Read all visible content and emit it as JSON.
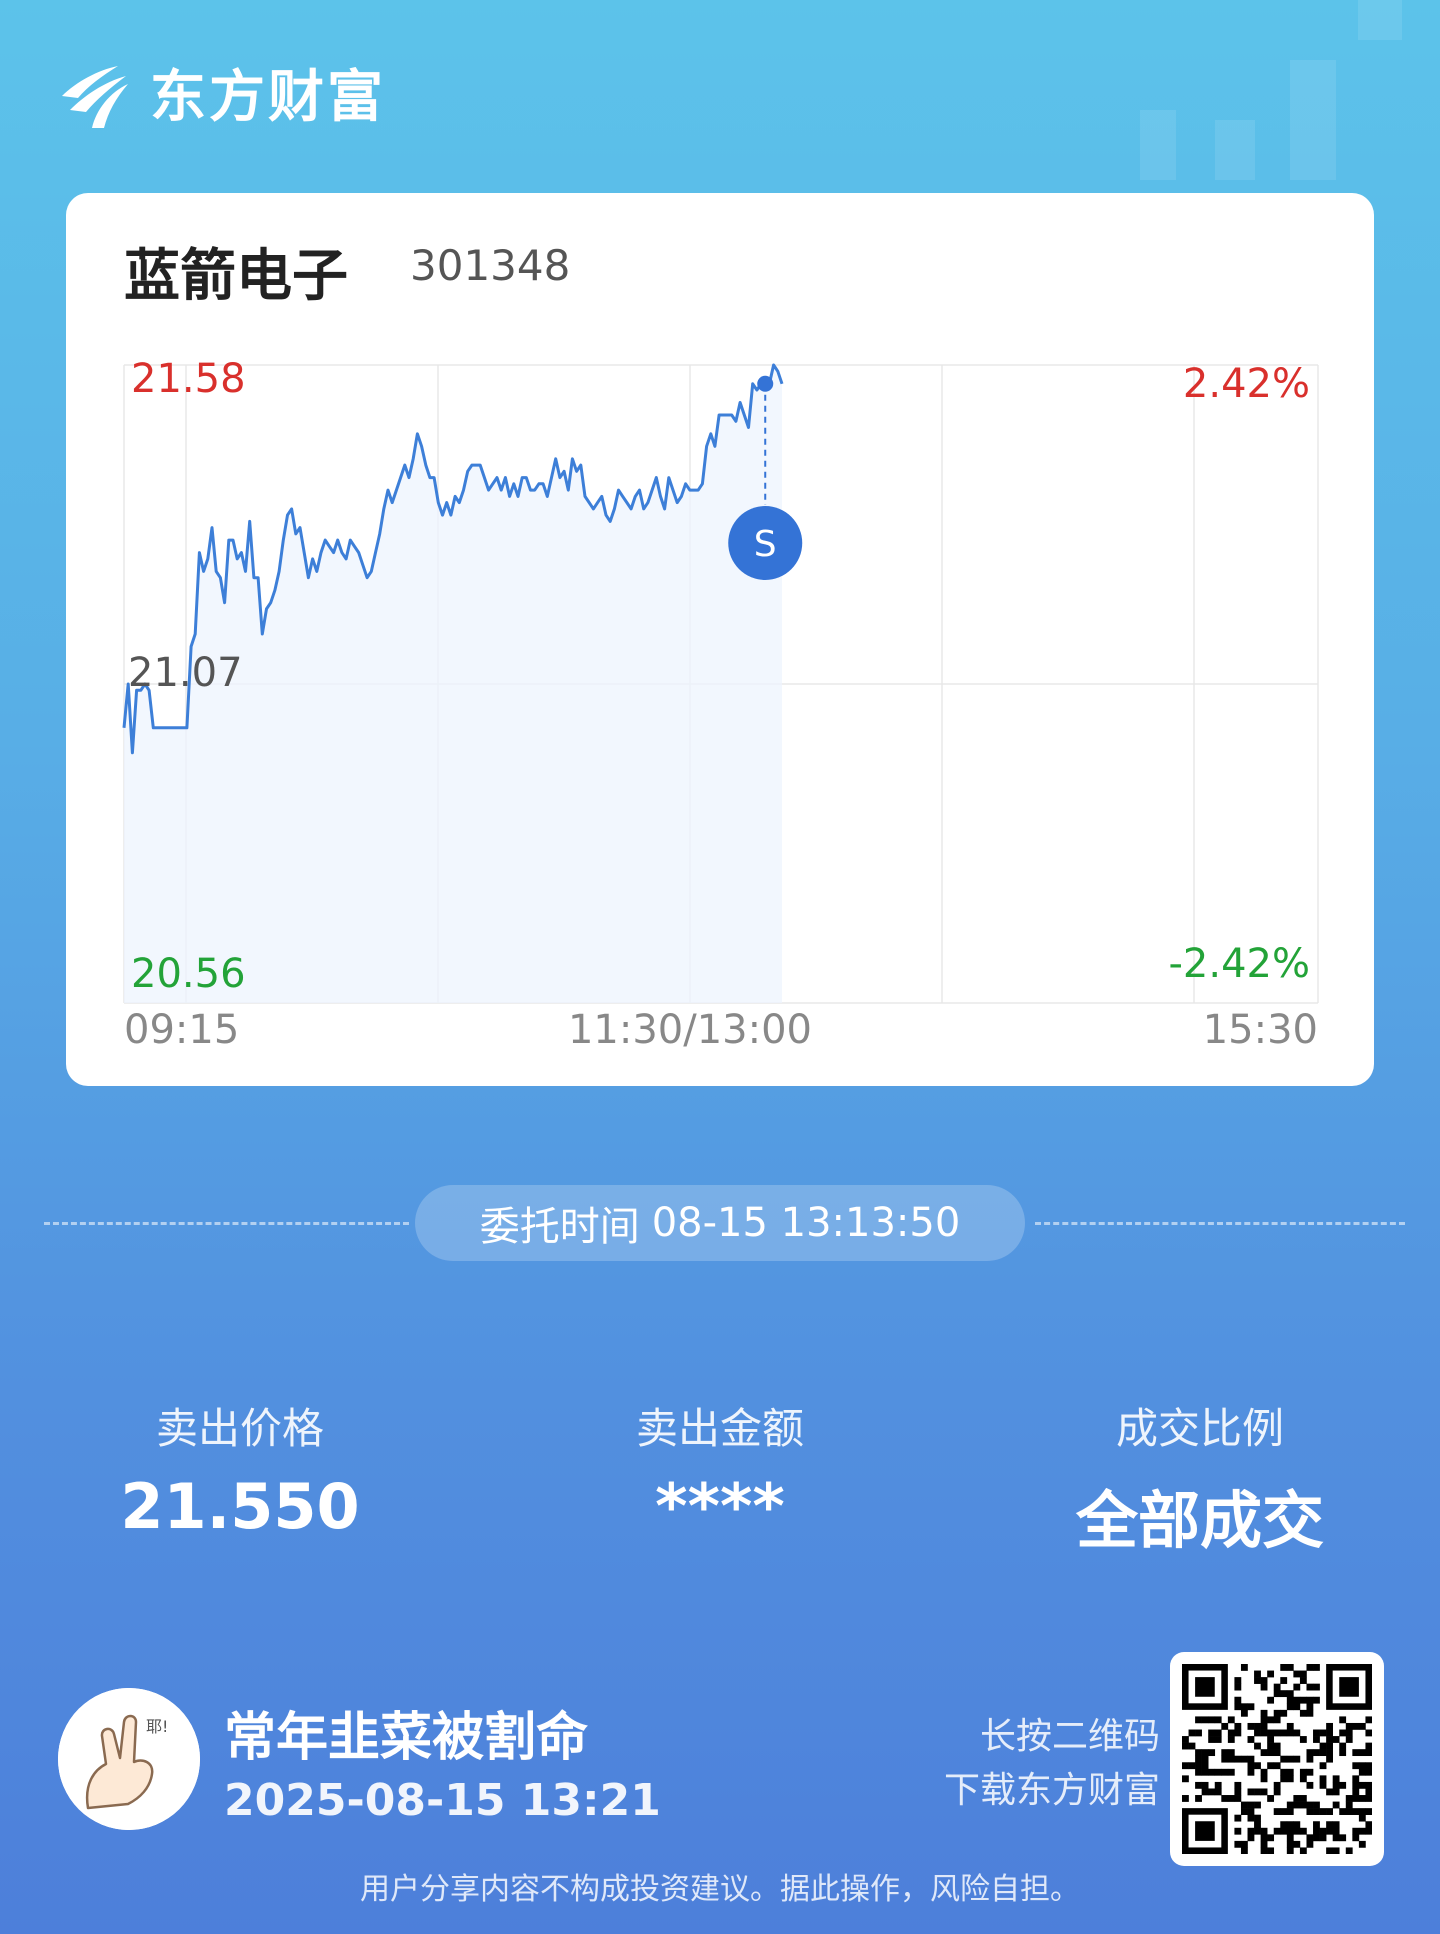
{
  "app": {
    "brand": "东方财富"
  },
  "stock": {
    "name": "蓝箭电子",
    "code": "301348"
  },
  "chart_data": {
    "type": "line",
    "y_axis_left": {
      "top": "21.58",
      "mid": "21.07",
      "bottom": "20.56"
    },
    "y_axis_right": {
      "top": "2.42%",
      "bottom": "-2.42%"
    },
    "x_ticks": [
      "09:15",
      "11:30/13:00",
      "15:30"
    ],
    "ylim": [
      20.56,
      21.58
    ],
    "grid": true,
    "series": [
      {
        "values": [
          21.0,
          21.07,
          20.96,
          21.06,
          21.06,
          21.07,
          21.06,
          21.0,
          21.0,
          21.0,
          21.0,
          21.0,
          21.0,
          21.0,
          21.0,
          21.0,
          21.13,
          21.15,
          21.28,
          21.25,
          21.27,
          21.32,
          21.25,
          21.24,
          21.2,
          21.3,
          21.3,
          21.27,
          21.28,
          21.25,
          21.33,
          21.24,
          21.24,
          21.15,
          21.19,
          21.2,
          21.22,
          21.25,
          21.3,
          21.34,
          21.35,
          21.31,
          21.32,
          21.28,
          21.24,
          21.27,
          21.25,
          21.28,
          21.3,
          21.29,
          21.28,
          21.3,
          21.28,
          21.27,
          21.3,
          21.29,
          21.28,
          21.26,
          21.24,
          21.25,
          21.28,
          21.31,
          21.35,
          21.38,
          21.36,
          21.38,
          21.4,
          21.42,
          21.4,
          21.43,
          21.47,
          21.45,
          21.42,
          21.4,
          21.4,
          21.36,
          21.34,
          21.36,
          21.34,
          21.37,
          21.36,
          21.38,
          21.41,
          21.42,
          21.42,
          21.42,
          21.4,
          21.38,
          21.39,
          21.4,
          21.38,
          21.4,
          21.37,
          21.39,
          21.37,
          21.4,
          21.4,
          21.38,
          21.38,
          21.39,
          21.39,
          21.37,
          21.4,
          21.43,
          21.4,
          21.41,
          21.38,
          21.43,
          21.41,
          21.42,
          21.37,
          21.36,
          21.35,
          21.36,
          21.37,
          21.34,
          21.33,
          21.35,
          21.38,
          21.37,
          21.36,
          21.35,
          21.37,
          21.38,
          21.35,
          21.36,
          21.38,
          21.4,
          21.37,
          21.35,
          21.4,
          21.38,
          21.36,
          21.37,
          21.39,
          21.38,
          21.38,
          21.38,
          21.39,
          21.45,
          21.47,
          21.45,
          21.5,
          21.5,
          21.5,
          21.5,
          21.49,
          21.52,
          21.5,
          21.48,
          21.55,
          21.54,
          21.55,
          21.56,
          21.55,
          21.58,
          21.57,
          21.55
        ]
      }
    ],
    "marker": {
      "label": "S",
      "value": 21.55
    }
  },
  "order": {
    "label": "委托时间",
    "value": "08-15 13:13:50"
  },
  "stats": [
    {
      "label": "卖出价格",
      "value": "21.550"
    },
    {
      "label": "卖出金额",
      "value": "****"
    },
    {
      "label": "成交比例",
      "value": "全部成交"
    }
  ],
  "user": {
    "nickname": "常年韭菜被割命",
    "time": "2025-08-15 13:21",
    "avatar_text": "耶!"
  },
  "qr": {
    "tip1": "长按二维码",
    "tip2": "下载东方财富"
  },
  "disclaimer": "用户分享内容不构成投资建议。据此操作，风险自担。",
  "colors": {
    "up": "#d9302c",
    "down": "#23a338",
    "line": "#3d7fd8",
    "marker": "#3473d6"
  }
}
